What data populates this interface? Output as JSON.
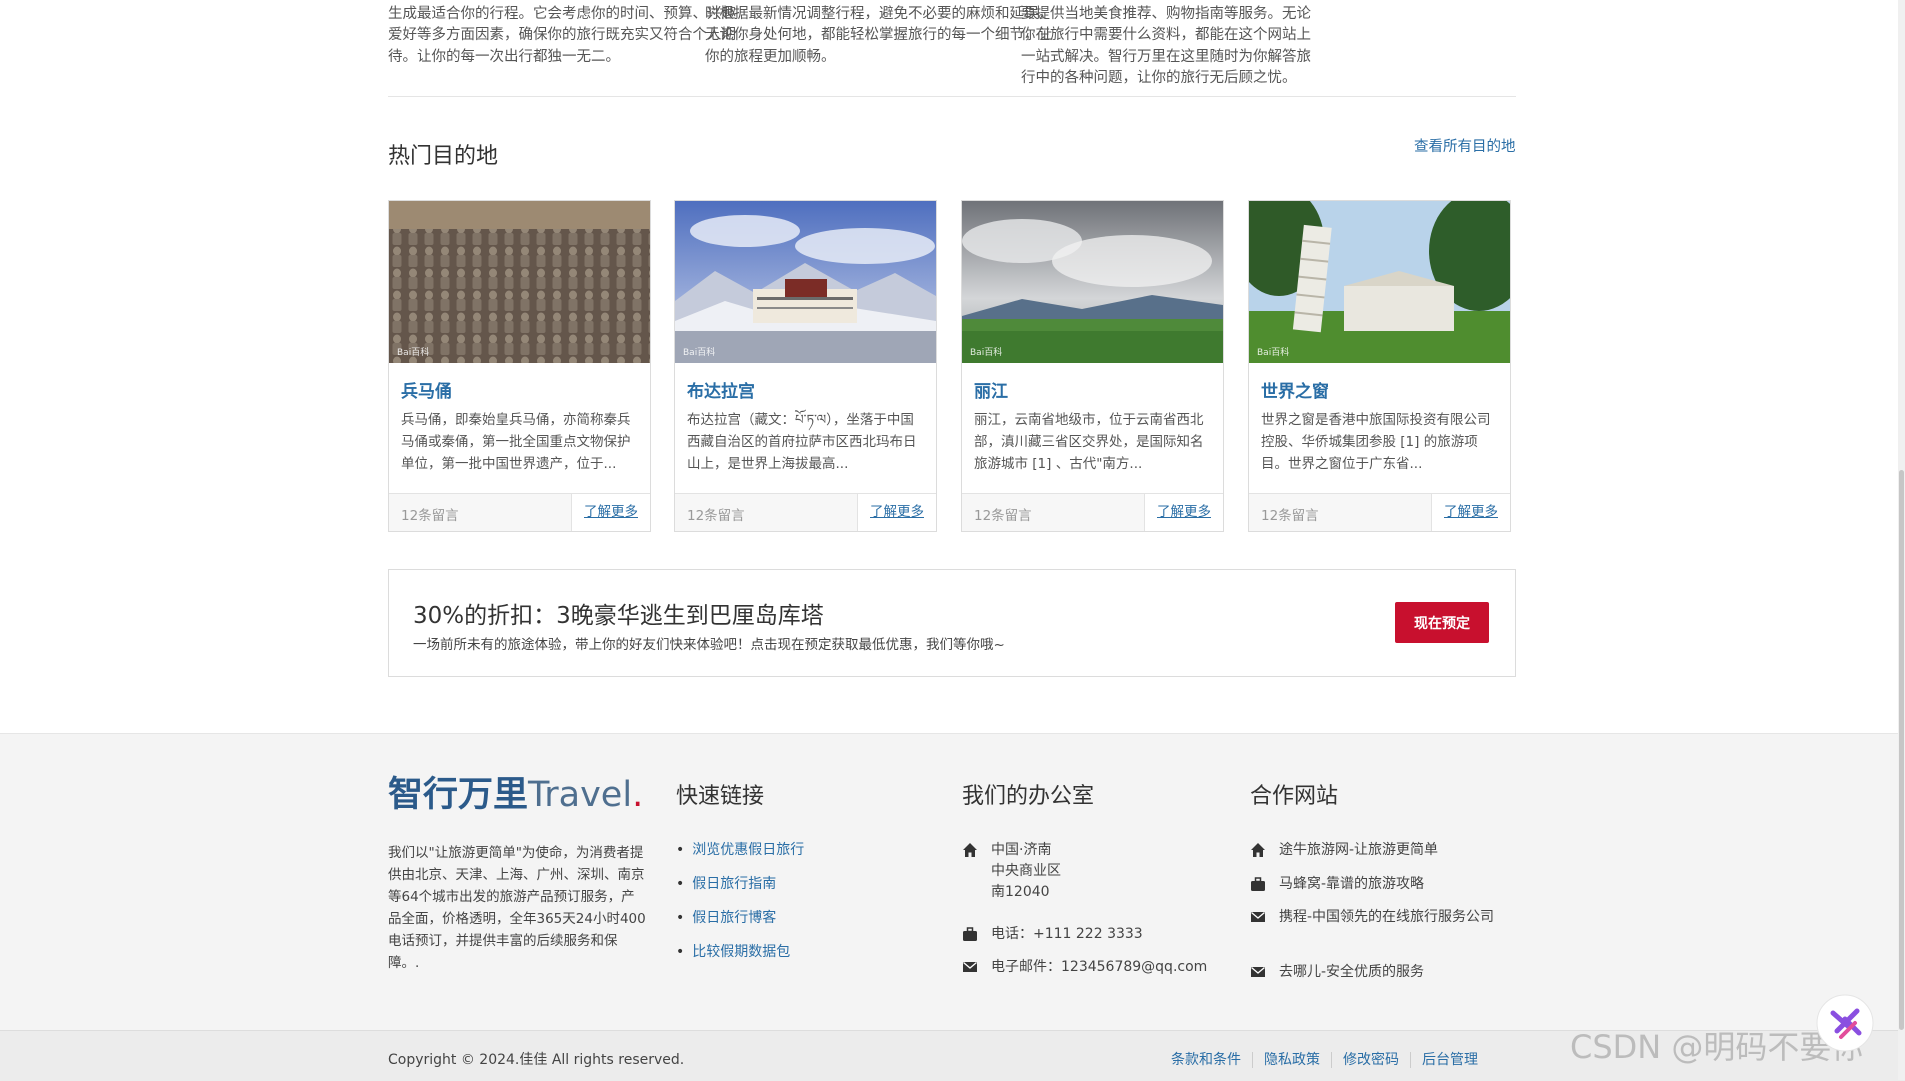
{
  "intro": {
    "col1": "新，还是追求刺激冒险的，开新，在网站的帮你安排并生成最适合你的行程。它会考虑你的时间、预算、兴趣爱好等多方面因素，确保你的旅行既充实又符合个人期待。让你的每一次出行都独一无二。",
    "col2": "目地的景点开放时间、天气变化等信息。智能系统会随时根据最新情况调整行程，避免不必要的麻烦和延误。无论你身处何地，都能轻松掌握旅行的每一个细节，让你的旅程更加顺畅。",
    "col3": "旅行中所需要的信息。网站中的服务还另以需要提供当地美食推荐、购物指南等服务。无论你在旅行中需要什么资料，都能在这个网站上一站式解决。智行万里在这里随时为你解答旅行中的各种问题，让你的旅行无后顾之忧。"
  },
  "destinations": {
    "title": "热门目的地",
    "view_all": "查看所有目的地",
    "cards": [
      {
        "name": "兵马俑",
        "desc": "兵马俑，即秦始皇兵马俑，亦简称秦兵马俑或秦俑，第一批全国重点文物保护单位，第一批中国世界遗产，位于...",
        "comments": "12条留言",
        "more": "了解更多",
        "watermark": "Bai百科"
      },
      {
        "name": "布达拉宫",
        "desc": "布达拉宫（藏文：པོ་ཏ་ལ），坐落于中国西藏自治区的首府拉萨市区西北玛布日山上，是世界上海拔最高...",
        "comments": "12条留言",
        "more": "了解更多",
        "watermark": "Bai百科"
      },
      {
        "name": "丽江",
        "desc": "丽江，云南省地级市，位于云南省西北部，滇川藏三省区交界处，是国际知名旅游城市 [1] 、古代\"南方...",
        "comments": "12条留言",
        "more": "了解更多",
        "watermark": "Bai百科"
      },
      {
        "name": "世界之窗",
        "desc": "世界之窗是香港中旅国际投资有限公司控股、华侨城集团参股 [1] 的旅游项目。世界之窗位于广东省...",
        "comments": "12条留言",
        "more": "了解更多",
        "watermark": "Bai百科"
      }
    ]
  },
  "promo": {
    "title": "30%的折扣：3晚豪华逃生到巴厘岛库塔",
    "subtitle": "一场前所未有的旅途体验，带上你的好友们快来体验吧！点击现在预定获取最低优惠，我们等你哦~",
    "button": "现在预定"
  },
  "footer": {
    "brand_cn": "智行万里",
    "brand_en": "Travel",
    "brand_dot": ".",
    "about": "我们以\"让旅游更简单\"为使命，为消费者提供由北京、天津、上海、广州、深圳、南京等64个城市出发的旅游产品预订服务，产品全面，价格透明，全年365天24小时400电话预订，并提供丰富的后续服务和保障。.",
    "quick_links": {
      "title": "快速链接",
      "items": [
        "浏览优惠假日旅行",
        "假日旅行指南",
        "假日旅行博客",
        "比较假期数据包"
      ]
    },
    "office": {
      "title": "我们的办公室",
      "address": [
        "中国·济南",
        "中央商业区",
        "南12040"
      ],
      "phone": "电话：+111 222 3333",
      "email": "电子邮件：123456789@qq.com"
    },
    "partners": {
      "title": "合作网站",
      "items": [
        "途牛旅游网-让旅游更简单",
        "马蜂窝-靠谱的旅游攻略",
        "携程-中国领先的在线旅行服务公司",
        "去哪儿-安全优质的服务"
      ]
    }
  },
  "bottom": {
    "copyright": "Copyright © 2024.佳佳 All rights reserved.",
    "links": [
      "条款和条件",
      "隐私政策",
      "修改密码",
      "后台管理"
    ]
  },
  "watermark": "CSDN @明码不要你",
  "colors": {
    "link": "#2a6ea6",
    "accent": "#c8102e",
    "brand": "#2b5a8a"
  }
}
